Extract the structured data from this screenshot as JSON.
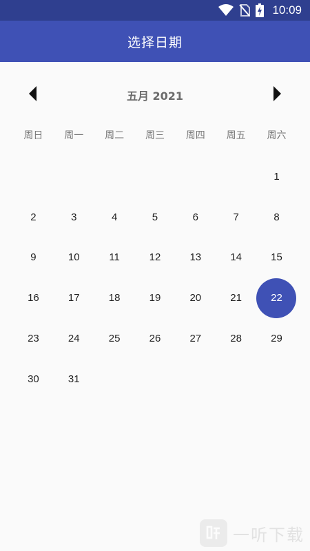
{
  "status_bar": {
    "time": "10:09",
    "icons": [
      "wifi-icon",
      "no-sim-icon",
      "battery-charging-icon"
    ]
  },
  "app_bar": {
    "title": "选择日期"
  },
  "calendar": {
    "month_label": "五月 2021",
    "weekdays": [
      "周日",
      "周一",
      "周二",
      "周三",
      "周四",
      "周五",
      "周六"
    ],
    "first_weekday_index": 6,
    "days": [
      "1",
      "2",
      "3",
      "4",
      "5",
      "6",
      "7",
      "8",
      "9",
      "10",
      "11",
      "12",
      "13",
      "14",
      "15",
      "16",
      "17",
      "18",
      "19",
      "20",
      "21",
      "22",
      "23",
      "24",
      "25",
      "26",
      "27",
      "28",
      "29",
      "30",
      "31"
    ],
    "selected_day": "22",
    "accent_color": "#3f51b5"
  },
  "watermark": {
    "text": "一听下载"
  }
}
